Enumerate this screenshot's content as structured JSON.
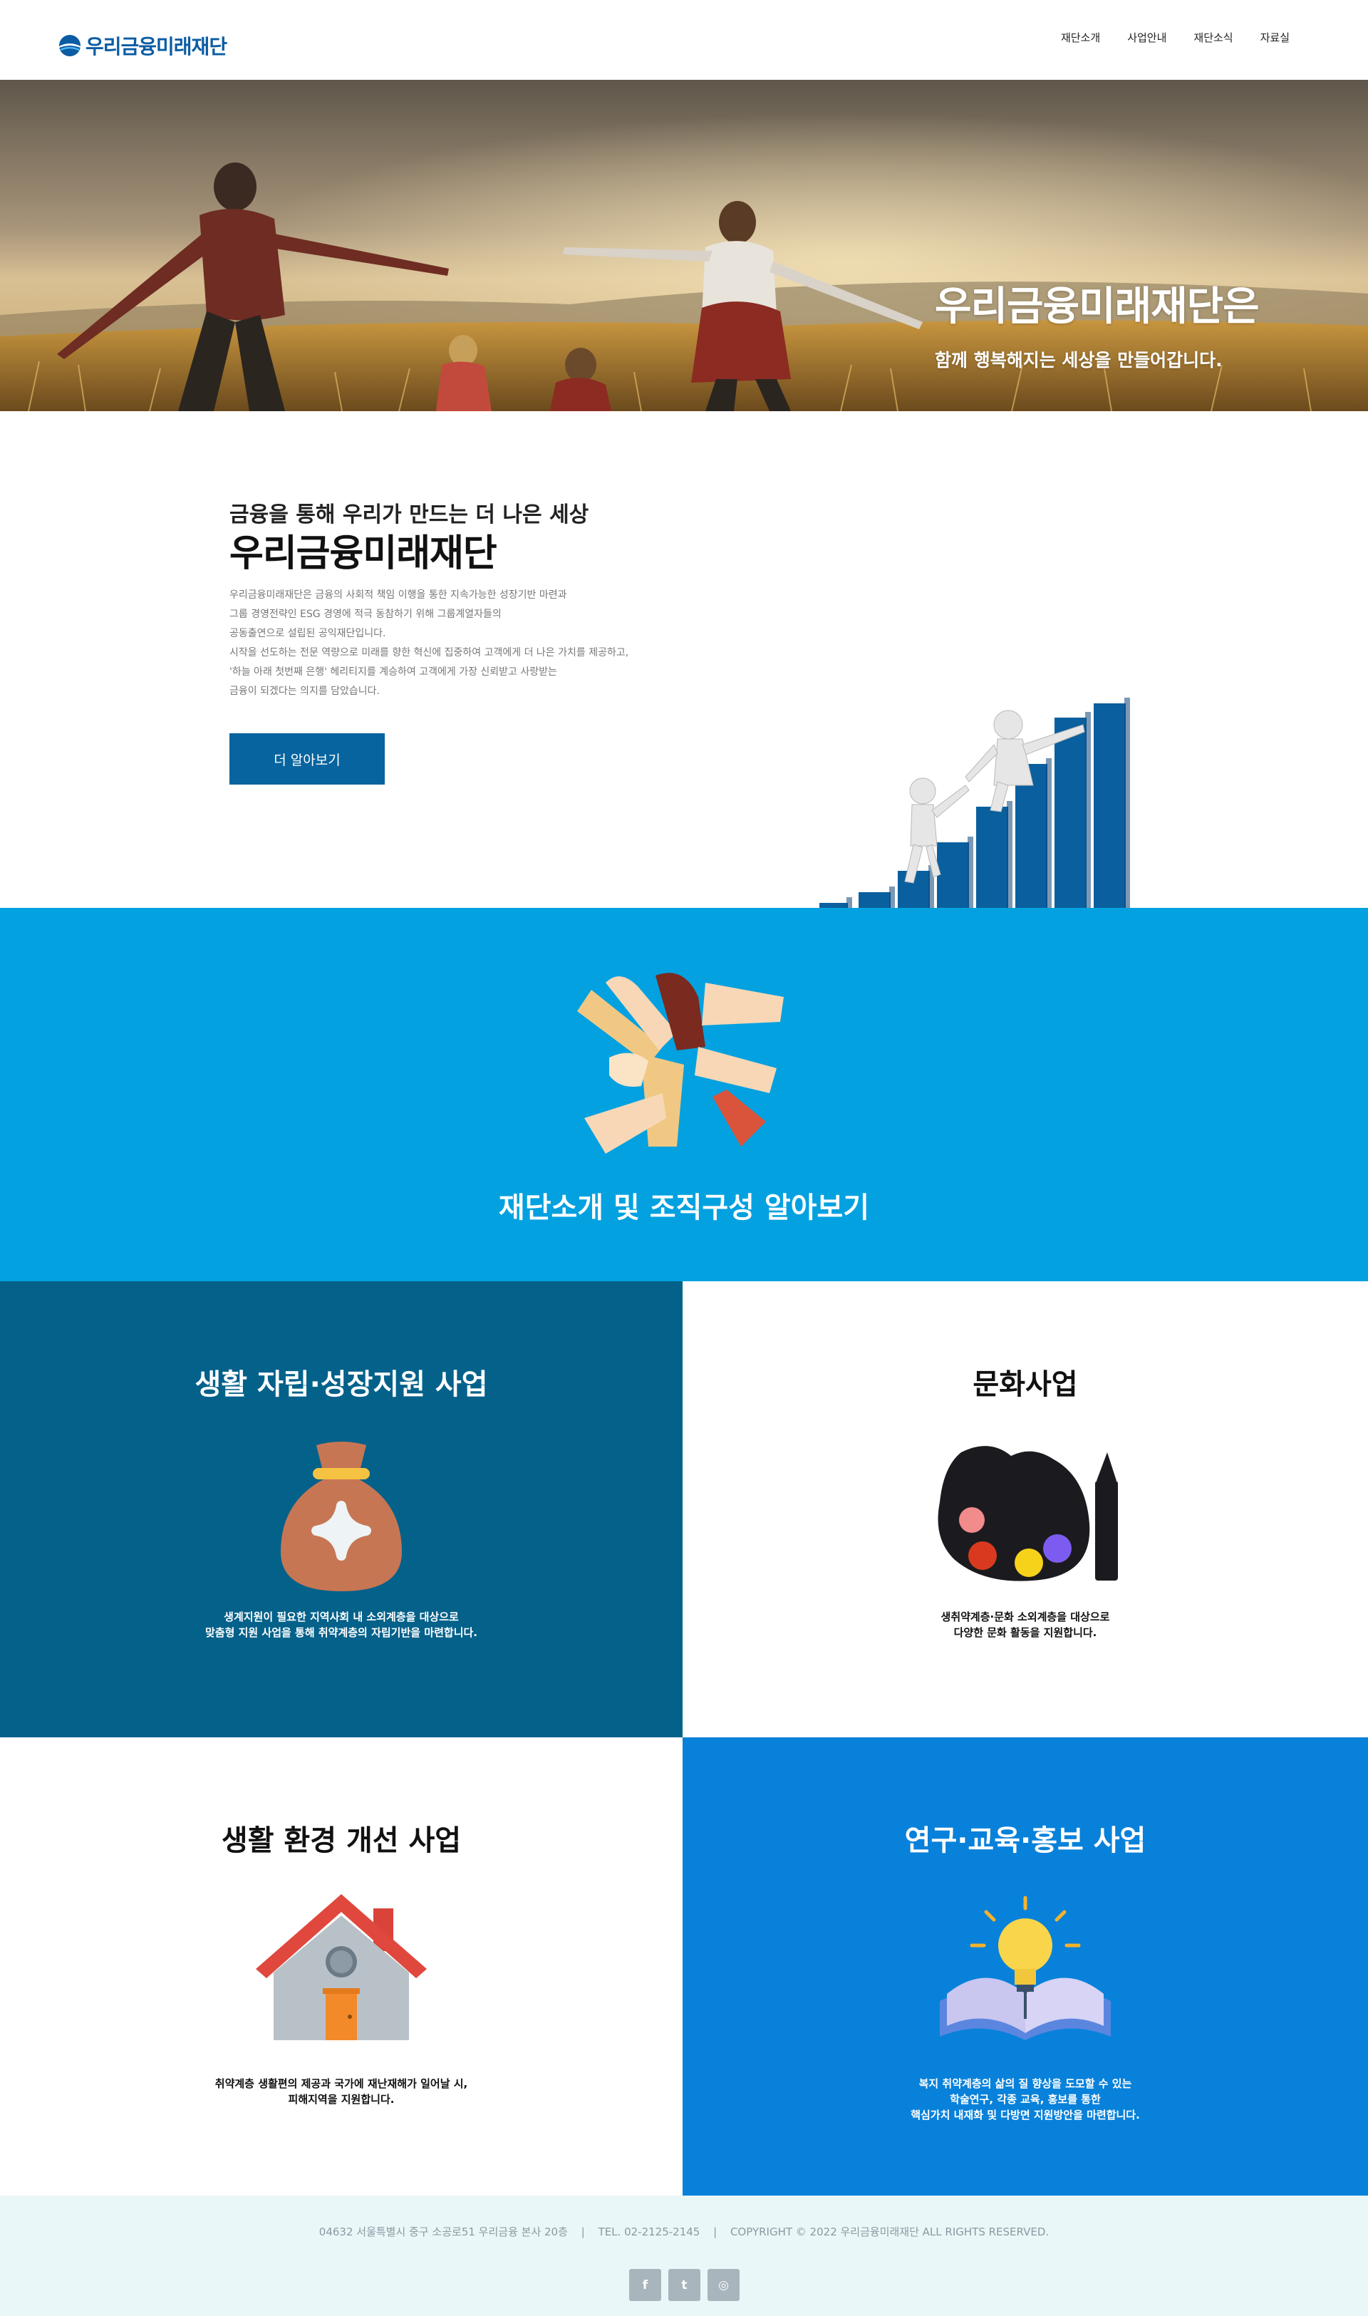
{
  "header": {
    "logo_text": "우리금융미래재단",
    "nav": [
      "재단소개",
      "사업안내",
      "재단소식",
      "자료실"
    ]
  },
  "hero": {
    "title": "우리금융미래재단은",
    "subtitle": "함께 행복해지는 세상을 만들어갑니다."
  },
  "about": {
    "kicker": "금융을 통해 우리가 만드는 더 나은 세상",
    "title": "우리금융미래재단",
    "body": [
      "우리금융미래재단은 금융의 사회적 책임 이행을 통한 지속가능한 성장기반 마련과",
      "그룹 경영전략인 ESG 경영에 적극 동참하기 위해 그룹계열자들의",
      "공동출연으로 설립된 공익재단입니다.",
      "시작을 선도하는 전문 역량으로 미래를 향한 혁신에 집중하여 고객에게 더 나은 가치를 제공하고,",
      "'하늘 아래 첫번째 은행' 헤리티지를 계승하여 고객에게 가장 신뢰받고 사랑받는",
      "금융이 되겠다는 의지를 담았습니다."
    ],
    "button_label": "더 알아보기"
  },
  "intro": {
    "title": "재단소개 및 조직구성 알아보기"
  },
  "programs": [
    {
      "title": "생활 자립·성장지원 사업",
      "icon": "money-bag-icon",
      "desc": [
        "생계지원이 필요한 지역사회 내 소외계층을 대상으로",
        "맞춤형 지원 사업을 통해 취약계층의 자립기반을 마련합니다."
      ]
    },
    {
      "title": "문화사업",
      "icon": "paint-palette-icon",
      "desc": [
        "생취약계층·문화 소외계층을 대상으로",
        "다양한 문화 활동을 지원합니다."
      ]
    },
    {
      "title": "생활 환경 개선 사업",
      "icon": "house-icon",
      "desc": [
        "취약계층 생활편의 제공과 국가에 재난재해가 일어날 시,",
        "피해지역을 지원합니다."
      ]
    },
    {
      "title": "연구·교육·홍보 사업",
      "icon": "book-lightbulb-icon",
      "desc": [
        "복지 취약계층의 삶의 질 향상을 도모할 수 있는",
        "학술연구, 각종 교육, 홍보를 통한",
        "핵심가치 내재화 및 다방면 지원방안을 마련합니다."
      ]
    }
  ],
  "colors": {
    "brand": "#0b5ca3",
    "button": "#07649e",
    "intro_bg": "#03a1e0",
    "program1_bg": "#04618a",
    "program4_bg": "#0881da",
    "footer_bg": "#eaf7f8"
  },
  "footer": {
    "address": "04632 서울특별시 중구 소공로51 우리금융 본사 20층",
    "tel": "TEL. 02-2125-2145",
    "copyright": "COPYRIGHT © 2022 우리금융미래재단 ALL RIGHTS RESERVED.",
    "separator": "|",
    "social": [
      {
        "name": "facebook-icon",
        "glyph": "f"
      },
      {
        "name": "twitter-icon",
        "glyph": "t"
      },
      {
        "name": "instagram-icon",
        "glyph": "◎"
      }
    ]
  }
}
